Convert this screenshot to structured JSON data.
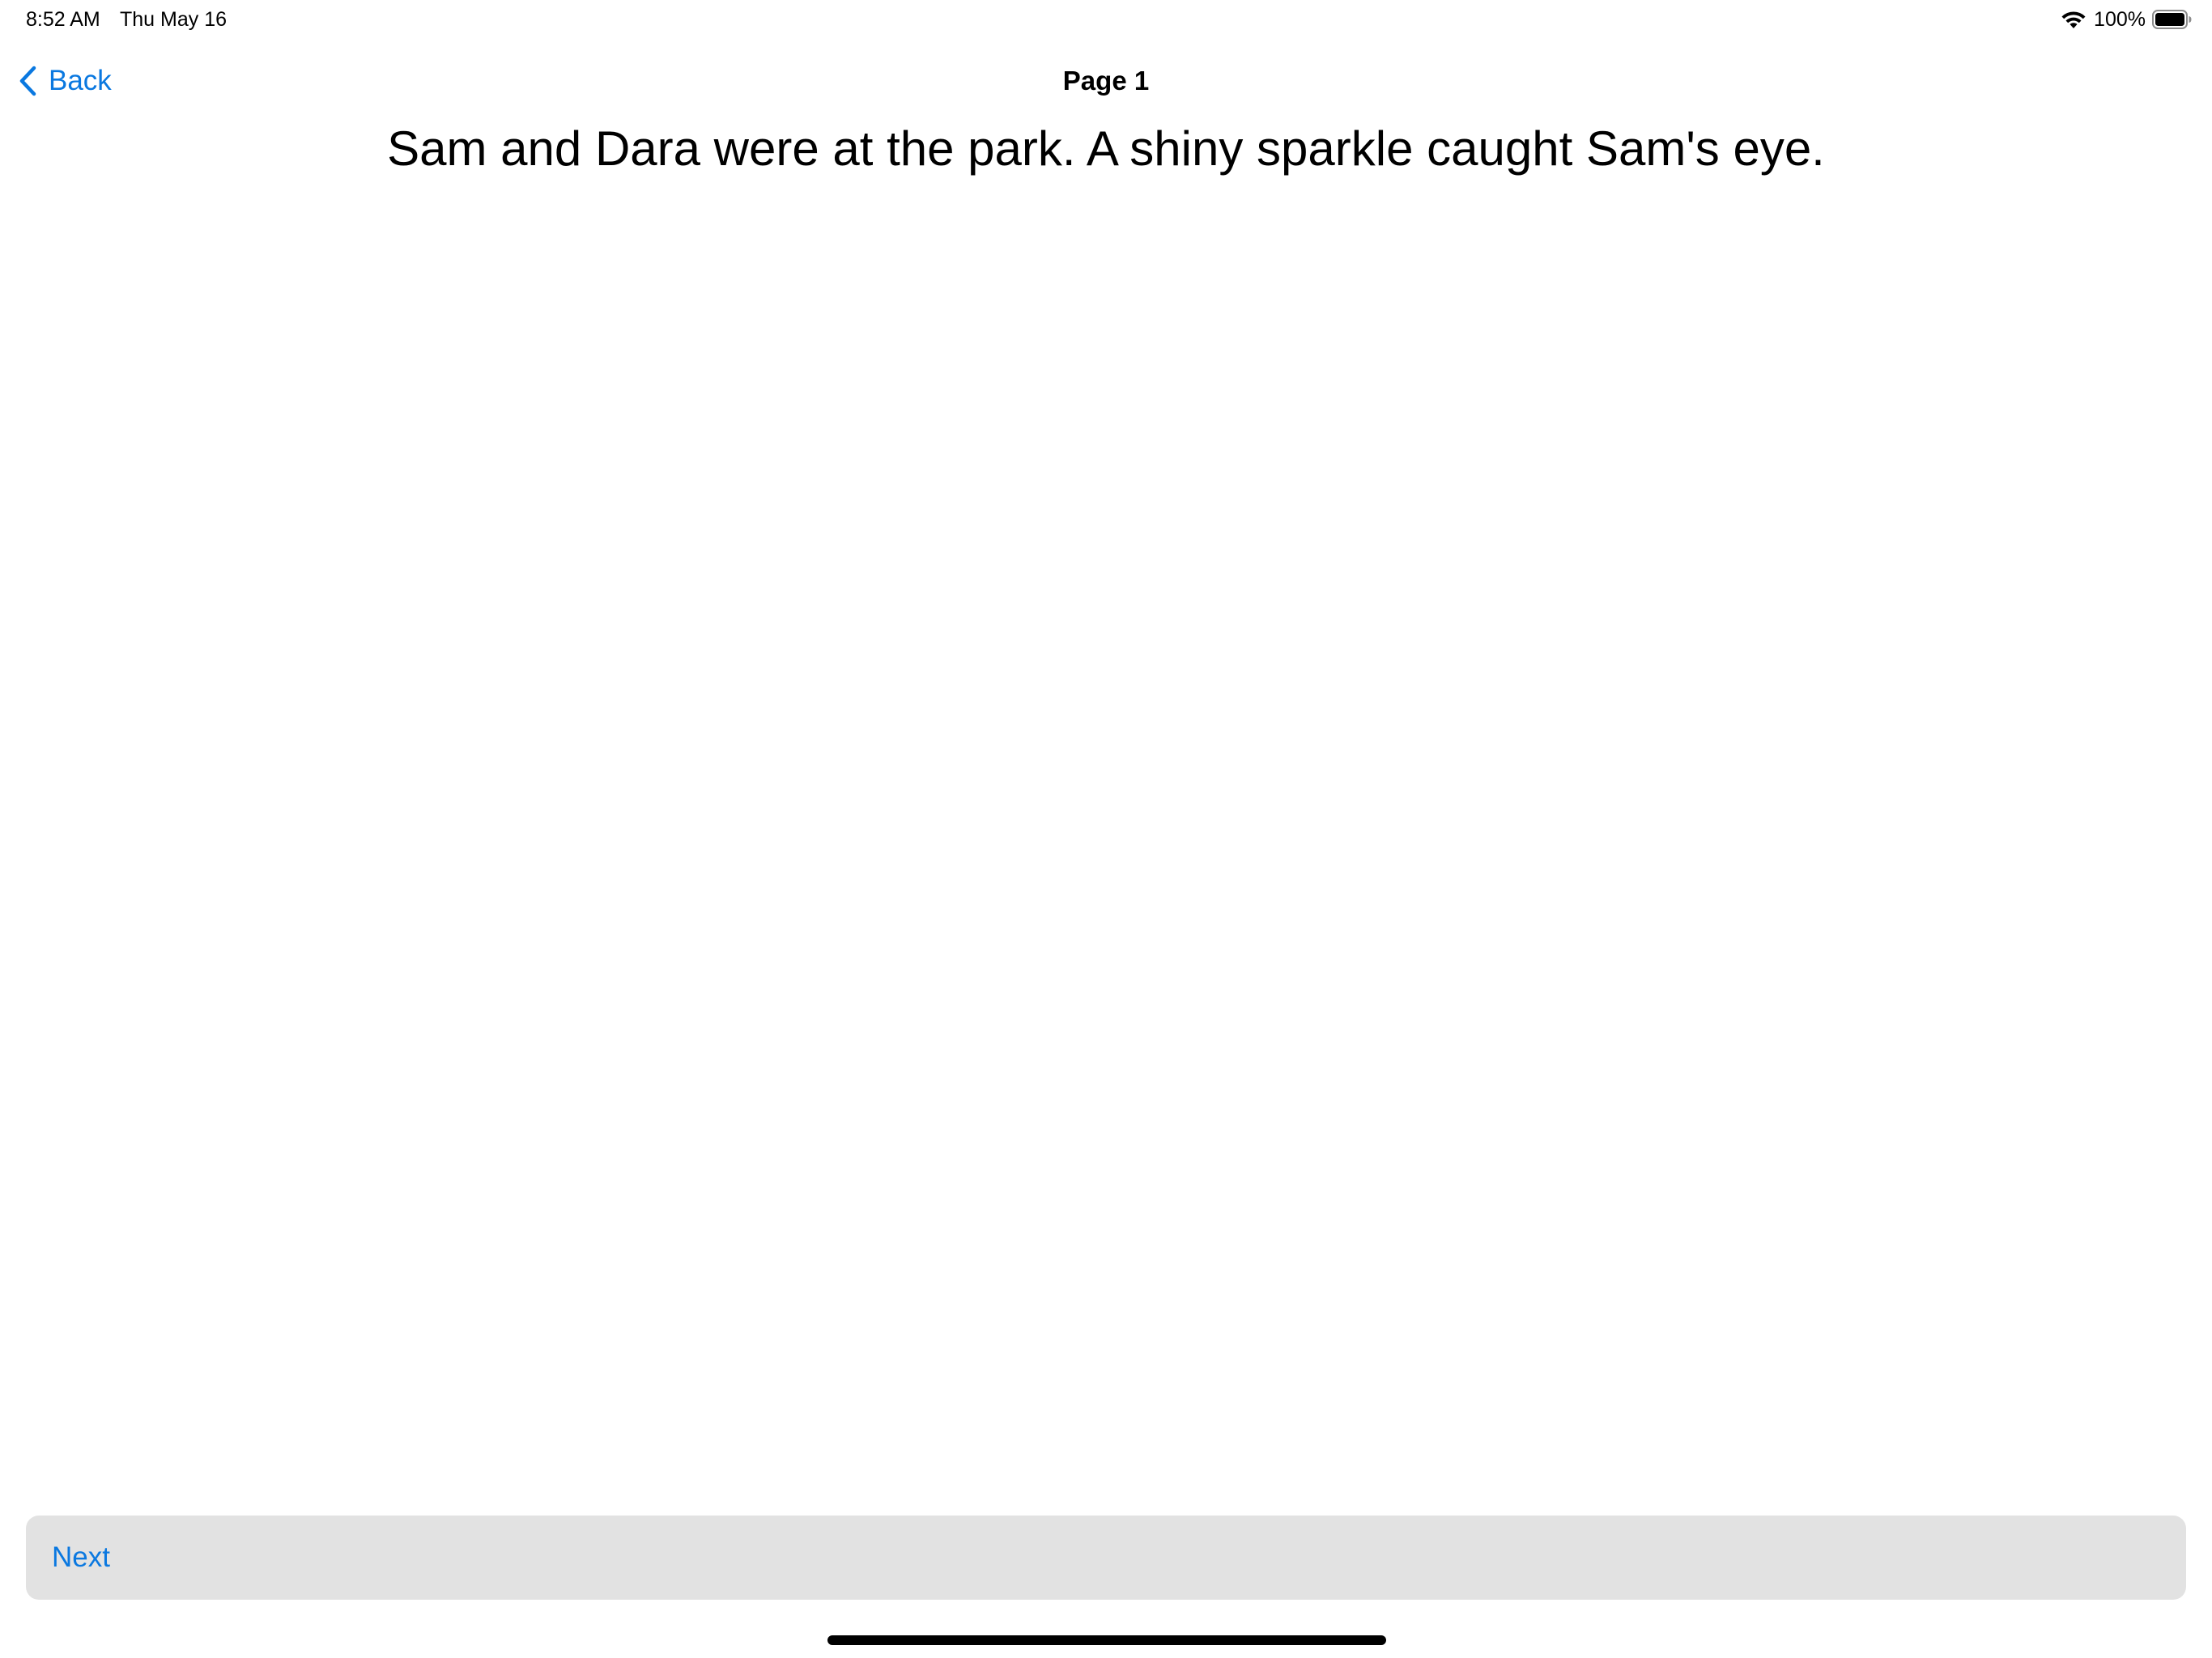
{
  "status_bar": {
    "time": "8:52 AM",
    "date": "Thu May 16",
    "battery_percent": "100%",
    "wifi_icon": "wifi-icon",
    "battery_icon": "battery-icon"
  },
  "nav": {
    "back_label": "Back",
    "back_icon": "chevron-left-icon",
    "title": "Page 1"
  },
  "story": {
    "text": "Sam and Dara were at the park. A shiny sparkle caught Sam's eye."
  },
  "footer": {
    "next_label": "Next"
  },
  "colors": {
    "accent": "#0a78e0",
    "button_background": "#e2e2e2",
    "text": "#000000",
    "background": "#ffffff"
  }
}
